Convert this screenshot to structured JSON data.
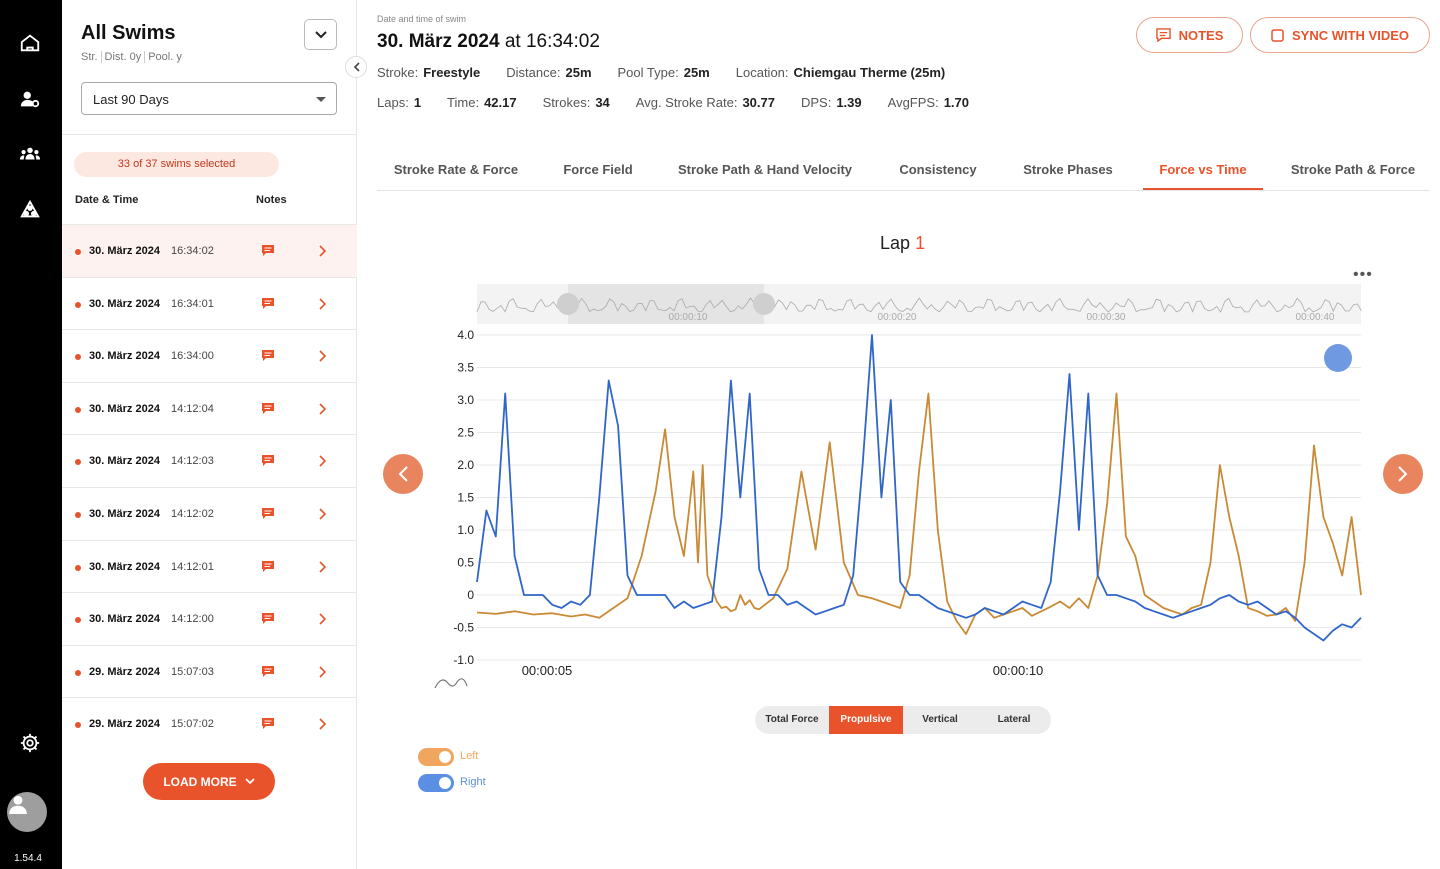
{
  "app": {
    "version": "1.54.4"
  },
  "sidebar": {
    "title": "All Swims",
    "subtitle": [
      "Str.",
      "Dist. 0y",
      "Pool. y"
    ],
    "period": "Last  90 Days",
    "selected_text": "33 of 37 swims selected",
    "col_date": "Date & Time",
    "col_notes": "Notes",
    "rows": [
      {
        "date": "30. März 2024",
        "time": "16:34:02"
      },
      {
        "date": "30. März 2024",
        "time": "16:34:01"
      },
      {
        "date": "30. März 2024",
        "time": "16:34:00"
      },
      {
        "date": "30. März 2024",
        "time": "14:12:04"
      },
      {
        "date": "30. März 2024",
        "time": "14:12:03"
      },
      {
        "date": "30. März 2024",
        "time": "14:12:02"
      },
      {
        "date": "30. März 2024",
        "time": "14:12:01"
      },
      {
        "date": "30. März 2024",
        "time": "14:12:00"
      },
      {
        "date": "29. März 2024",
        "time": "15:07:03"
      },
      {
        "date": "29. März 2024",
        "time": "15:07:02"
      }
    ],
    "load_more": "LOAD MORE"
  },
  "header": {
    "small_label": "Date and time of swim",
    "date": "30. März 2024",
    "at": "at",
    "time": "16:34:02",
    "notes_btn": "NOTES",
    "sync_btn": "SYNC WITH VIDEO",
    "meta1": [
      {
        "k": "Stroke:",
        "v": "Freestyle"
      },
      {
        "k": "Distance:",
        "v": "25m"
      },
      {
        "k": "Pool Type:",
        "v": "25m"
      },
      {
        "k": "Location:",
        "v": "Chiemgau Therme (25m)"
      }
    ],
    "meta2": [
      {
        "k": "Laps:",
        "v": "1"
      },
      {
        "k": "Time:",
        "v": "42.17"
      },
      {
        "k": "Strokes:",
        "v": "34"
      },
      {
        "k": "Avg. Stroke Rate:",
        "v": "30.77"
      },
      {
        "k": "DPS:",
        "v": "1.39"
      },
      {
        "k": "AvgFPS:",
        "v": "1.70"
      }
    ]
  },
  "tabs": [
    "Stroke Rate & Force",
    "Force Field",
    "Stroke Path & Hand Velocity",
    "Consistency",
    "Stroke Phases",
    "Force vs Time",
    "Stroke Path & Force"
  ],
  "active_tab": "Force vs Time",
  "lap": {
    "label": "Lap",
    "number": "1"
  },
  "force_modes": [
    "Total Force",
    "Propulsive",
    "Vertical",
    "Lateral"
  ],
  "active_mode": "Propulsive",
  "toggles": [
    {
      "label": "Left",
      "color": "#f0a65f"
    },
    {
      "label": "Right",
      "color": "#5b8fe3"
    }
  ],
  "colors": {
    "accent": "#e8532b",
    "left_series": "#c98a36",
    "right_series": "#2f66c8"
  },
  "chart_data": {
    "type": "line",
    "ylim": [
      -1.0,
      4.0
    ],
    "yticks": [
      "4.0",
      "3.5",
      "3.0",
      "2.5",
      "2.0",
      "1.5",
      "1.0",
      "0.5",
      "0",
      "-0.5",
      "-1.0"
    ],
    "xticks": [
      "00:00:05",
      "00:00:10"
    ],
    "navigator_ticks": [
      "00:00:10",
      "00:00:20",
      "00:00:30",
      "00:00:40"
    ],
    "series": [
      {
        "name": "Left",
        "color": "#c98a36",
        "x": [
          0,
          0.4,
          0.8,
          1.2,
          1.6,
          2.0,
          2.3,
          2.6,
          2.9,
          3.2,
          3.5,
          3.8,
          4.0,
          4.2,
          4.4,
          4.6,
          4.7,
          4.8,
          4.9,
          5.0,
          5.1,
          5.2,
          5.3,
          5.4,
          5.5,
          5.6,
          5.7,
          5.8,
          5.9,
          6.0,
          6.3,
          6.6,
          6.9,
          7.2,
          7.5,
          7.8,
          8.1,
          8.4,
          8.6,
          8.8,
          9.0,
          9.2,
          9.4,
          9.6,
          9.8,
          10.0,
          10.2,
          10.4,
          10.6,
          10.8,
          11.0,
          11.2,
          11.4,
          11.6,
          11.8,
          12.0,
          12.2,
          12.4,
          12.6,
          12.8,
          13.0,
          13.2,
          13.4,
          13.6,
          13.8,
          14.0,
          14.2,
          14.4,
          14.6,
          14.8,
          15.0,
          15.2,
          15.4,
          15.6,
          15.8,
          16.0,
          16.2,
          16.4,
          16.6,
          16.8,
          17.0,
          17.2,
          17.4,
          17.6,
          17.8,
          18.0,
          18.2,
          18.4,
          18.6,
          18.8
        ],
        "y": [
          -0.27,
          -0.29,
          -0.25,
          -0.3,
          -0.28,
          -0.33,
          -0.3,
          -0.35,
          -0.2,
          -0.05,
          0.6,
          1.6,
          2.55,
          1.2,
          0.6,
          1.9,
          0.5,
          2.0,
          0.3,
          0.1,
          -0.1,
          -0.2,
          -0.18,
          -0.25,
          -0.22,
          0.0,
          -0.15,
          -0.08,
          -0.2,
          -0.22,
          -0.05,
          0.4,
          1.9,
          0.7,
          2.35,
          0.5,
          0.0,
          -0.05,
          -0.1,
          -0.15,
          -0.2,
          0.3,
          1.9,
          3.1,
          1.0,
          -0.1,
          -0.4,
          -0.6,
          -0.3,
          -0.2,
          -0.35,
          -0.3,
          -0.25,
          -0.2,
          -0.32,
          -0.25,
          -0.18,
          -0.1,
          -0.2,
          -0.05,
          -0.2,
          0.3,
          1.4,
          3.1,
          0.9,
          0.6,
          0.0,
          -0.1,
          -0.2,
          -0.25,
          -0.3,
          -0.2,
          -0.15,
          0.5,
          2.0,
          1.2,
          0.6,
          -0.2,
          -0.25,
          -0.32,
          -0.3,
          -0.2,
          -0.4,
          0.5,
          2.3,
          1.2,
          0.8,
          0.3,
          1.2,
          0.0
        ]
      },
      {
        "name": "Right",
        "color": "#2f66c8",
        "x": [
          0,
          0.2,
          0.4,
          0.6,
          0.8,
          1.0,
          1.2,
          1.4,
          1.6,
          1.8,
          2.0,
          2.2,
          2.4,
          2.6,
          2.8,
          3.0,
          3.2,
          3.4,
          3.6,
          3.8,
          4.0,
          4.2,
          4.4,
          4.6,
          4.8,
          5.0,
          5.2,
          5.4,
          5.6,
          5.8,
          6.0,
          6.2,
          6.4,
          6.6,
          6.8,
          7.0,
          7.2,
          7.4,
          7.6,
          7.8,
          8.0,
          8.2,
          8.4,
          8.6,
          8.8,
          9.0,
          9.2,
          9.4,
          9.6,
          9.8,
          10.0,
          10.2,
          10.4,
          10.6,
          10.8,
          11.0,
          11.2,
          11.4,
          11.6,
          11.8,
          12.0,
          12.2,
          12.4,
          12.6,
          12.8,
          13.0,
          13.2,
          13.4,
          13.6,
          13.8,
          14.0,
          14.2,
          14.4,
          14.6,
          14.8,
          15.0,
          15.2,
          15.4,
          15.6,
          15.8,
          16.0,
          16.2,
          16.4,
          16.6,
          16.8,
          17.0,
          17.2,
          17.4,
          17.6,
          17.8,
          18.0,
          18.2,
          18.4,
          18.6,
          18.8
        ],
        "y": [
          0.2,
          1.3,
          0.9,
          3.1,
          0.6,
          0.0,
          0.0,
          0.0,
          -0.15,
          -0.2,
          -0.1,
          -0.15,
          0.0,
          1.5,
          3.3,
          2.6,
          0.3,
          0.0,
          0.0,
          0.0,
          0.0,
          -0.2,
          -0.1,
          -0.2,
          -0.15,
          -0.1,
          1.2,
          3.3,
          1.5,
          3.1,
          0.4,
          0.0,
          0.0,
          -0.15,
          -0.1,
          -0.2,
          -0.3,
          -0.25,
          -0.2,
          -0.15,
          0.3,
          2.0,
          4.0,
          1.5,
          3.0,
          0.2,
          0.0,
          0.0,
          -0.1,
          -0.2,
          -0.25,
          -0.3,
          -0.35,
          -0.3,
          -0.2,
          -0.25,
          -0.3,
          -0.2,
          -0.1,
          -0.15,
          -0.2,
          0.2,
          1.6,
          3.4,
          1.0,
          3.1,
          0.3,
          0.0,
          0.0,
          -0.05,
          -0.1,
          -0.2,
          -0.25,
          -0.3,
          -0.35,
          -0.3,
          -0.25,
          -0.2,
          -0.15,
          -0.05,
          0.0,
          -0.1,
          -0.15,
          -0.1,
          -0.2,
          -0.3,
          -0.25,
          -0.35,
          -0.5,
          -0.6,
          -0.7,
          -0.55,
          -0.45,
          -0.5,
          -0.35
        ]
      }
    ]
  }
}
